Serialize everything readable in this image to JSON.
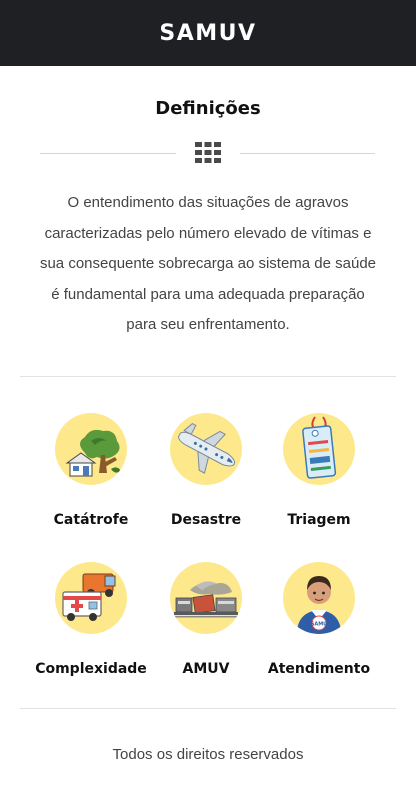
{
  "header": {
    "title": "SAMUV"
  },
  "section": {
    "title": "Definições"
  },
  "intro": {
    "lines": [
      "O entendimento das situações de agravos",
      "caracterizadas pelo número elevado de vítimas e",
      "sua consequente sobrecarga ao sistema de saúde",
      "é fundamental para uma adequada preparação",
      "para seu enfrentamento."
    ]
  },
  "tiles": [
    {
      "label": "Catátrofe",
      "icon": "house-tree-icon"
    },
    {
      "label": "Desastre",
      "icon": "airplane-icon"
    },
    {
      "label": "Triagem",
      "icon": "triage-tag-icon"
    },
    {
      "label": "Complexidade",
      "icon": "ambulance-truck-icon"
    },
    {
      "label": "AMUV",
      "icon": "train-wreck-icon"
    },
    {
      "label": "Atendimento",
      "icon": "paramedic-icon"
    }
  ],
  "badge": {
    "samu_text": "SAMU"
  },
  "footer": {
    "text": "Todos os direitos reservados"
  },
  "colors": {
    "header_bg": "#1f2023",
    "icon_circle": "#fde98c",
    "text_muted": "#444444"
  }
}
